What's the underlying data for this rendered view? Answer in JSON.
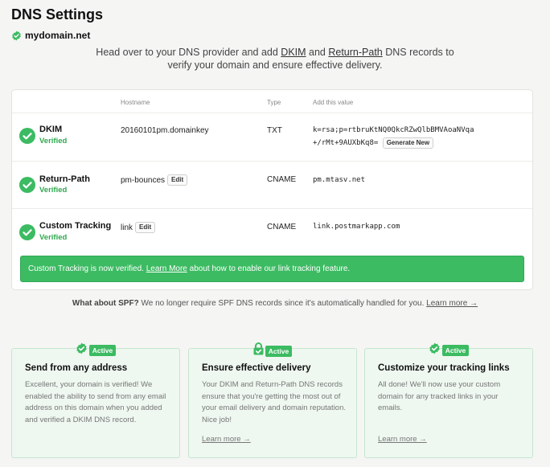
{
  "page": {
    "title": "DNS Settings",
    "domain": "mydomain.net",
    "intro": {
      "part1": "Head over to your DNS provider and add ",
      "dkim_link": "DKIM",
      "part2": " and ",
      "return_path_link": "Return-Path",
      "part3": " DNS records to",
      "line2": "verify your domain and ensure effective delivery."
    }
  },
  "table": {
    "headers": {
      "hostname": "Hostname",
      "type": "Type",
      "value": "Add this value"
    },
    "records": [
      {
        "name": "DKIM",
        "status": "Verified",
        "hostname": "20160101pm.domainkey",
        "type": "TXT",
        "value_line1": "k=rsa;p=rtbruKtNQ0QkcRZwQlbBMVAoaNVqa",
        "value_line2": "+/rMt+9AUXbKq8=",
        "action": "Generate New"
      },
      {
        "name": "Return-Path",
        "status": "Verified",
        "hostname": "pm-bounces",
        "hostname_action": "Edit",
        "type": "CNAME",
        "value": "pm.mtasv.net"
      },
      {
        "name": "Custom Tracking",
        "status": "Verified",
        "hostname": "link",
        "hostname_action": "Edit",
        "type": "CNAME",
        "value": "link.postmarkapp.com"
      }
    ],
    "notice": {
      "part1": "Custom Tracking is now verified. ",
      "link": "Learn More",
      "part2": " about how to enable our link tracking feature."
    }
  },
  "spf": {
    "question": "What about SPF?",
    "text": " We no longer require SPF DNS records since it's automatically handled for you. ",
    "link": "Learn more →"
  },
  "cards": [
    {
      "badge": "Active",
      "icon": "verified-badge-icon",
      "title": "Send from any address",
      "body": "Excellent, your domain is verified! We enabled the ability to send from any email address on this domain when you added and verified a DKIM DNS record."
    },
    {
      "badge": "Active",
      "icon": "lock-icon",
      "title": "Ensure effective delivery",
      "body": "Your DKIM and Return-Path DNS records ensure that you're getting the most out of your email delivery and domain reputation. Nice job!",
      "link": "Learn more →"
    },
    {
      "badge": "Active",
      "icon": "verified-badge-icon",
      "title": "Customize your tracking links",
      "body": "All done! We'll now use your custom domain for any tracked links in your emails.",
      "link": "Learn more →"
    }
  ],
  "colors": {
    "accent": "#3cbb62",
    "status_green": "#2fa84f",
    "background": "#f5f5f4"
  }
}
